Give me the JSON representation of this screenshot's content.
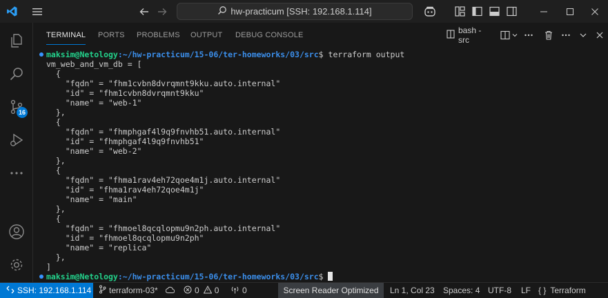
{
  "titlebar": {
    "search_text": "hw-practicum [SSH: 192.168.1.114]",
    "icons": [
      "vscode-logo",
      "menu",
      "back-arrow",
      "forward-arrow",
      "search",
      "copilot",
      "layout",
      "toggle-sidebar",
      "toggle-panel",
      "toggle-secondary-sidebar",
      "minimize",
      "maximize",
      "close"
    ]
  },
  "activitybar": {
    "icons": [
      "explorer",
      "search",
      "source-control",
      "run-and-debug",
      "more",
      "account",
      "manage"
    ],
    "source_control_badge": "16"
  },
  "panel": {
    "tabs": [
      "TERMINAL",
      "PORTS",
      "PROBLEMS",
      "OUTPUT",
      "DEBUG CONSOLE"
    ],
    "active_tab": "TERMINAL",
    "terminal_name": "bash - src"
  },
  "terminal": {
    "prompt_user": "maksim@Netology",
    "prompt_path": ":~/hw-practicum/15-06/ter-homeworks/03/src",
    "prompt_symbol": "$",
    "command": " terraform output",
    "output_lines": [
      "vm_web_and_vm_db = [",
      "  {",
      "    \"fqdn\" = \"fhm1cvbn8dvrqmnt9kku.auto.internal\"",
      "    \"id\" = \"fhm1cvbn8dvrqmnt9kku\"",
      "    \"name\" = \"web-1\"",
      "  },",
      "  {",
      "    \"fqdn\" = \"fhmphgaf4l9q9fnvhb51.auto.internal\"",
      "    \"id\" = \"fhmphgaf4l9q9fnvhb51\"",
      "    \"name\" = \"web-2\"",
      "  },",
      "  {",
      "    \"fqdn\" = \"fhma1rav4eh72qoe4m1j.auto.internal\"",
      "    \"id\" = \"fhma1rav4eh72qoe4m1j\"",
      "    \"name\" = \"main\"",
      "  },",
      "  {",
      "    \"fqdn\" = \"fhmoel8qcqlopmu9n2ph.auto.internal\"",
      "    \"id\" = \"fhmoel8qcqlopmu9n2ph\"",
      "    \"name\" = \"replica\"",
      "  },",
      "]"
    ]
  },
  "statusbar": {
    "remote": "SSH: 192.168.1.114",
    "branch": "terraform-03*",
    "errors": "0",
    "warnings": "0",
    "ports": "0",
    "screen_reader": "Screen Reader Optimized",
    "position": "Ln 1, Col 23",
    "spaces": "Spaces: 4",
    "encoding": "UTF-8",
    "eol": "LF",
    "language": "Terraform"
  },
  "colors": {
    "accent": "#0078d4",
    "prompt_user": "#23d18b",
    "prompt_path": "#3b8eea",
    "background": "#181818"
  }
}
